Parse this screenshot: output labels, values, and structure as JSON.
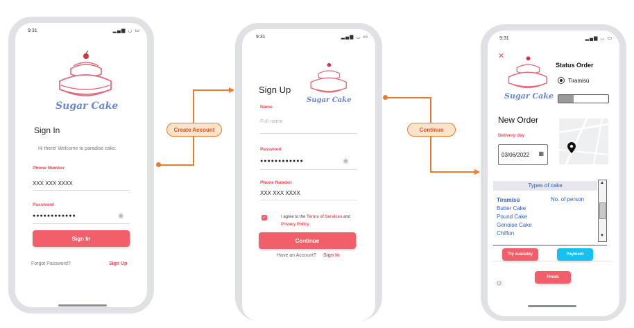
{
  "status_time": "9:31",
  "status_icons": "▂▄▆ ◡ ▭",
  "logo_text": "Sugar Cake",
  "flow": {
    "create_account": "Create Account",
    "continue": "Continue"
  },
  "signin": {
    "title": "Sign In",
    "welcome": "Hi there! Welcome to paradise cake.",
    "phone_label": "Phone Number",
    "phone_value": "XXX XXX XXXX",
    "password_label": "Password",
    "password_value": "●●●●●●●●●●●●",
    "button": "Sign In",
    "forgot": "Forgot Password?",
    "signup_link": "Sign Up"
  },
  "signup": {
    "title": "Sign Up",
    "name_label": "Name",
    "name_placeholder": "Full name",
    "password_label": "Password",
    "password_value": "●●●●●●●●●●●●",
    "phone_label": "Phone Number",
    "phone_value": "XXX XXX XXXX",
    "agree_prefix": "I agree to the",
    "terms": "Terms of Services",
    "and": "and",
    "privacy": "Privacy Policy.",
    "button": "Continue",
    "have_account": "Have an Account?",
    "signin_link": "Sign In"
  },
  "order": {
    "close_icon": "✕",
    "status_title": "Status Order",
    "status_item": "Tiramisú",
    "status_progress": 0.3,
    "new_order_title": "New Order",
    "delivery_label": "Delivery day",
    "delivery_date": "03/06/2022",
    "types_header": "Types of cake",
    "types": [
      "Tiramisú",
      "Butter Cake",
      "Pound Cake",
      "Genoise Cake",
      "Chiffon"
    ],
    "no_person": "No. of person",
    "try_button": "Try availably",
    "payment_button": "Payment",
    "finish_button": "Finish"
  },
  "colors": {
    "accent": "#f25f6a",
    "connector": "#f07a2a",
    "payment": "#17c0f0",
    "link_blue": "#3b66c4"
  }
}
